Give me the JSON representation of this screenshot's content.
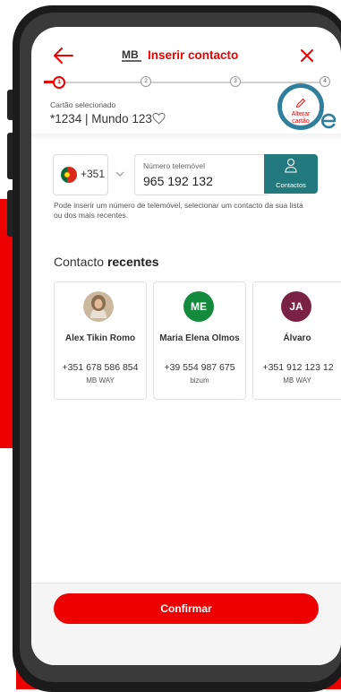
{
  "header": {
    "back_icon": "arrow-left-icon",
    "logo": "MB",
    "title": "Inserir contacto",
    "close_icon": "close-icon"
  },
  "stepper": {
    "steps": [
      "1",
      "2",
      "3",
      "4"
    ],
    "current": 1
  },
  "card": {
    "label": "Cartão selecionado",
    "value": "*1234 | Mundo 123",
    "favorite_icon": "heart-outline-icon",
    "edit_label_line1": "Alterar",
    "edit_label_line2": "cartão",
    "edit_icon": "pencil-icon"
  },
  "phone_input": {
    "country_code": "+351",
    "country_flag": "portugal-flag-icon",
    "label": "Número telemóvel",
    "value": "965 192 132",
    "contacts_label": "Contactos",
    "contacts_icon": "person-icon",
    "helper_text": "Pode inserir um número de telemóvel, selecionar um contacto da sua lista ou dos mais recentes."
  },
  "recent": {
    "title_prefix": "Contacto ",
    "title_bold": "recentes",
    "contacts": [
      {
        "name": "Alex Tikin Romo",
        "phone": "+351 678 586 854",
        "method": "MB WAY",
        "initials": "",
        "avatar_color": "#8a6d4f"
      },
      {
        "name": "Maria Elena Olmos",
        "phone": "+39 554 987 675",
        "method": "bizum",
        "initials": "ME",
        "avatar_color": "#138a3c"
      },
      {
        "name": "Álvaro",
        "phone": "+351 912 123 12",
        "method": "MB WAY",
        "initials": "JA",
        "avatar_color": "#7a2245"
      }
    ]
  },
  "footer": {
    "confirm_label": "Confirmar"
  },
  "colors": {
    "brand_red": "#ec0000",
    "teal": "#227a7e",
    "highlight_ring": "#2f7e9c"
  }
}
